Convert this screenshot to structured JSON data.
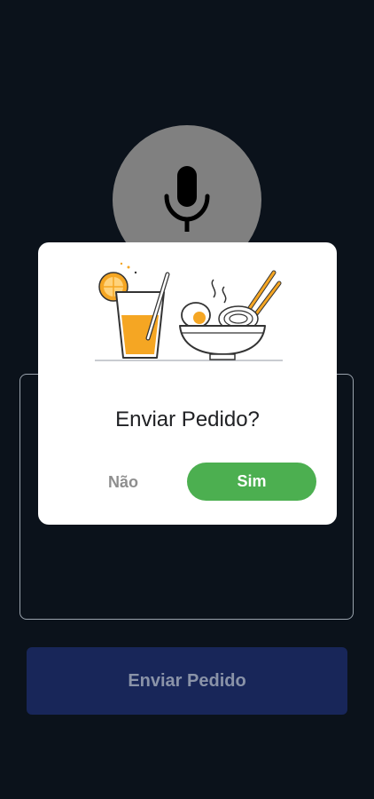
{
  "background_color": "#0b121b",
  "mic": {
    "icon": "microphone-icon",
    "color": "#808080"
  },
  "send_button": {
    "label": "Enviar Pedido",
    "color": "#182659"
  },
  "dialog": {
    "illustration": "drink-and-ramen-illustration",
    "title": "Enviar Pedido?",
    "no_label": "Não",
    "yes_label": "Sim",
    "yes_color": "#4caf50"
  }
}
